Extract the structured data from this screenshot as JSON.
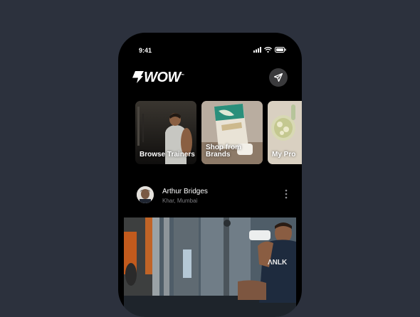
{
  "status_bar": {
    "time": "9:41"
  },
  "header": {
    "logo": "WOW",
    "logo_mark": "™"
  },
  "cards": [
    {
      "label": "Browse Trainers"
    },
    {
      "label": "Shop from Brands"
    },
    {
      "label": "My Pro"
    }
  ],
  "post": {
    "user_name": "Arthur Bridges",
    "location": "Khar, Mumbai",
    "shirt_text": "ΛNLK"
  }
}
